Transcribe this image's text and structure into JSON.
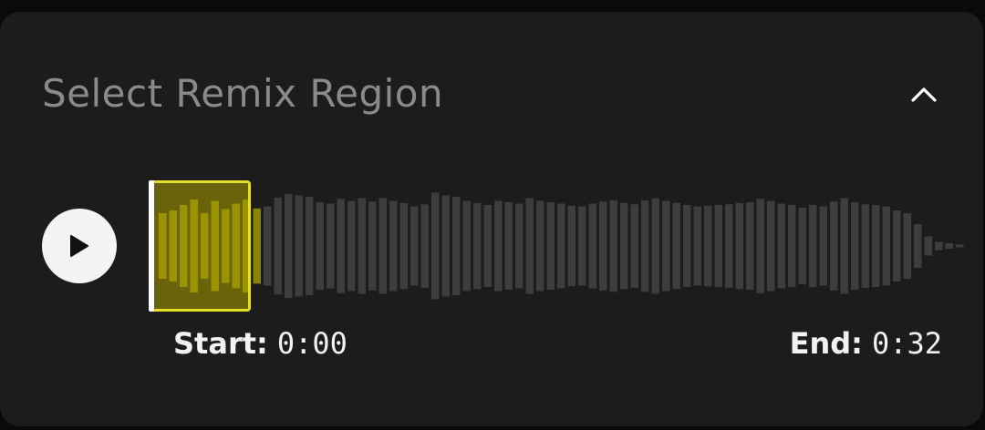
{
  "panel": {
    "title": "Select Remix Region",
    "collapse_icon": "chevron-up-icon"
  },
  "player": {
    "play_icon": "play-icon"
  },
  "region": {
    "start_label": "Start:",
    "start_value": "0:00",
    "end_label": "End:",
    "end_value": "0:32"
  },
  "colors": {
    "background": "#1c1c1c",
    "waveform_bar": "#3d3d3d",
    "selection_fill": "#8a8300",
    "selection_border": "#e5df2a"
  },
  "waveform": {
    "selected_bar_count": 10,
    "amplitudes": [
      0.48,
      0.52,
      0.6,
      0.68,
      0.48,
      0.66,
      0.54,
      0.62,
      0.68,
      0.55,
      0.58,
      0.71,
      0.76,
      0.74,
      0.72,
      0.64,
      0.62,
      0.69,
      0.66,
      0.7,
      0.65,
      0.7,
      0.66,
      0.63,
      0.58,
      0.61,
      0.78,
      0.74,
      0.72,
      0.66,
      0.63,
      0.6,
      0.66,
      0.64,
      0.62,
      0.7,
      0.66,
      0.64,
      0.62,
      0.59,
      0.58,
      0.62,
      0.65,
      0.67,
      0.63,
      0.61,
      0.67,
      0.7,
      0.66,
      0.63,
      0.6,
      0.58,
      0.59,
      0.6,
      0.61,
      0.63,
      0.64,
      0.69,
      0.66,
      0.62,
      0.6,
      0.56,
      0.6,
      0.58,
      0.65,
      0.7,
      0.64,
      0.61,
      0.6,
      0.58,
      0.52,
      0.48,
      0.32,
      0.14,
      0.06,
      0.04,
      0.02
    ]
  }
}
